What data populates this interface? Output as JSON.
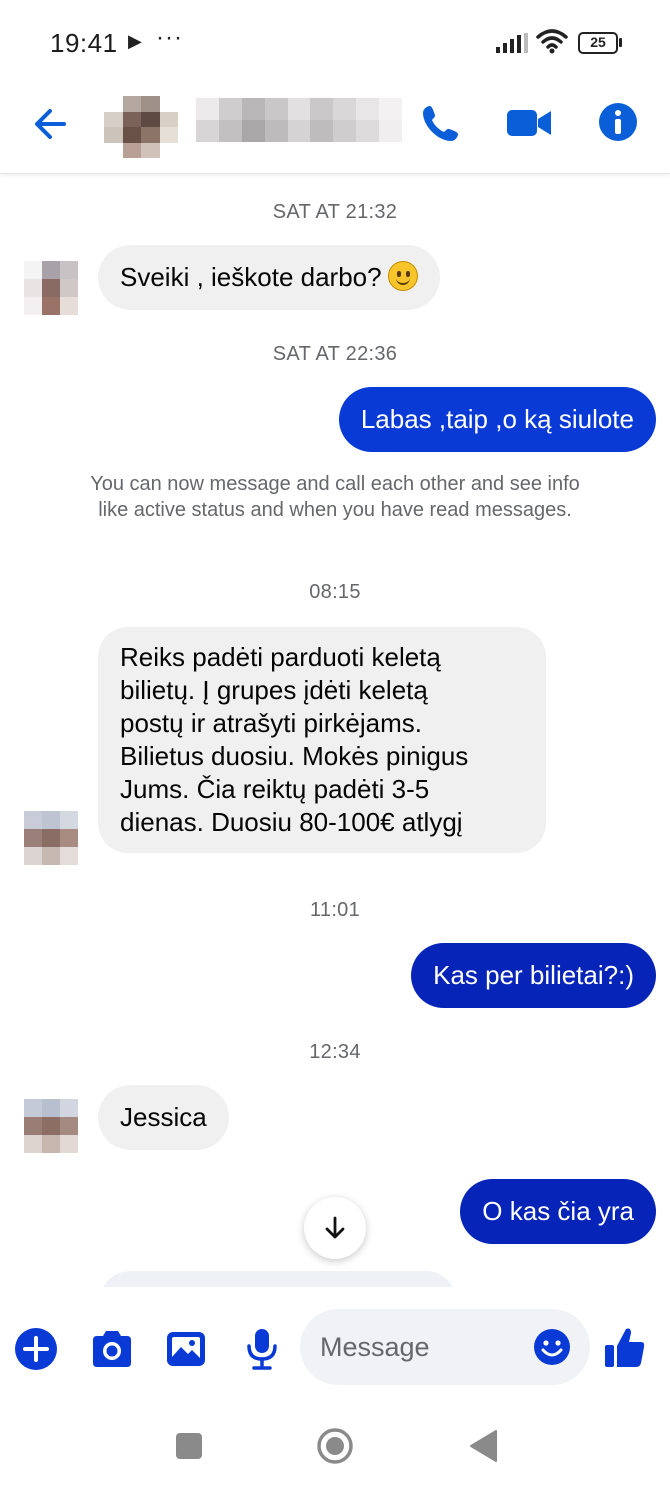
{
  "status_bar": {
    "time": "19:41",
    "play_glyph": "▶",
    "more_glyph": "···",
    "battery": "25"
  },
  "header": {
    "back_icon": "arrow-left-icon",
    "call_icon": "phone-icon",
    "video_icon": "video-camera-icon",
    "info_icon": "info-icon",
    "accent": "#0a5fd8"
  },
  "messages": {
    "ts1": "SAT AT 21:32",
    "m1": "Sveiki , ieškote darbo?",
    "ts2": "SAT AT 22:36",
    "m2": "Labas ,taip ,o ką siulote",
    "system_note": "You can now message and call each other and see info like active status and when you have read messages.",
    "ts3": "08:15",
    "m3_lines": [
      "Reiks padėti parduoti keletą",
      "bilietų. Į grupes įdėti keletą",
      "postų ir atrašyti pirkėjams.",
      "Bilietus duosiu. Mokės pinigus",
      "Jums. Čia reiktų padėti 3-5",
      "dienas. Duosiu 80-100€ atlygį"
    ],
    "ts4": "11:01",
    "m4": "Kas per bilietai?:)",
    "ts5": "12:34",
    "m5": "Jessica",
    "m6": "O kas čia yra"
  },
  "composer": {
    "placeholder": "Message",
    "icons": [
      "plus-icon",
      "camera-icon",
      "image-icon",
      "microphone-icon",
      "emoji-icon",
      "thumbs-up-icon"
    ]
  },
  "colors": {
    "outgoing": "#0a3ad6",
    "incoming": "#f0f0f0",
    "accent": "#0a5fd8"
  }
}
